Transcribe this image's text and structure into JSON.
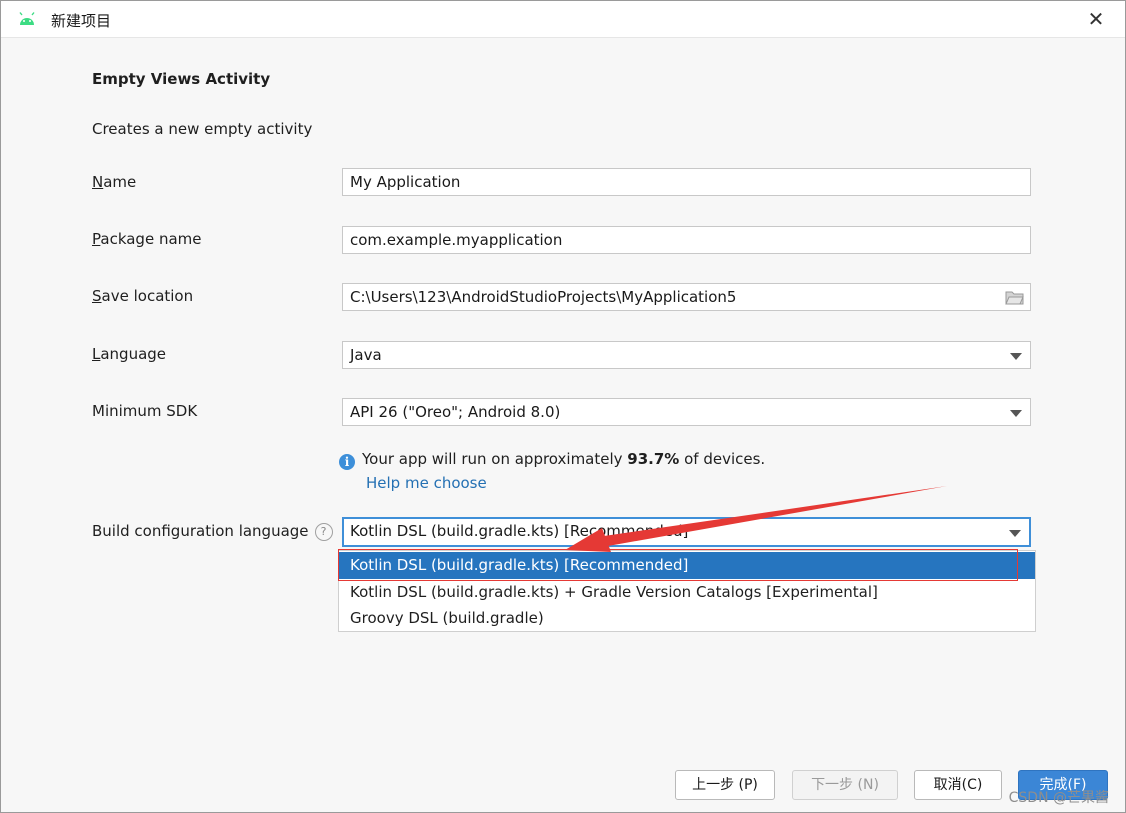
{
  "window": {
    "title": "新建项目",
    "close_label": "✕"
  },
  "activity": {
    "heading": "Empty Views Activity",
    "description": "Creates a new empty activity"
  },
  "form": {
    "name": {
      "label_mnemonic": "N",
      "label_rest": "ame",
      "value": "My Application"
    },
    "package": {
      "label_mnemonic": "P",
      "label_rest": "ackage name",
      "value": "com.example.myapplication"
    },
    "save_location": {
      "label_mnemonic": "S",
      "label_rest": "ave location",
      "value": "C:\\Users\\123\\AndroidStudioProjects\\MyApplication5"
    },
    "language": {
      "label_mnemonic": "L",
      "label_rest": "anguage",
      "value": "Java"
    },
    "min_sdk": {
      "label": "Minimum SDK",
      "value": "API 26 (\"Oreo\"; Android 8.0)"
    },
    "info": {
      "prefix": "Your app will run on approximately ",
      "percent": "93.7%",
      "suffix": " of devices."
    },
    "help_link": "Help me choose",
    "build_config": {
      "label": "Build configuration language",
      "value": "Kotlin DSL (build.gradle.kts) [Recommended]",
      "options": [
        "Kotlin DSL (build.gradle.kts) [Recommended]",
        "Kotlin DSL (build.gradle.kts) + Gradle Version Catalogs [Experimental]",
        "Groovy DSL (build.gradle)"
      ],
      "selected_index": 0
    }
  },
  "footer": {
    "prev": "上一步 (P)",
    "next": "下一步 (N)",
    "cancel": "取消(C)",
    "finish": "完成(F)"
  },
  "watermark": "CSDN @芒果酱",
  "colors": {
    "accent": "#2675bf",
    "focus_border": "#3f8fd8",
    "annotation_red": "#e53935",
    "link": "#2470b3"
  },
  "icons": {
    "app": "android-icon",
    "folder": "folder-icon",
    "info": "info-icon",
    "help": "question-icon",
    "dropdown": "chevron-down-icon"
  }
}
